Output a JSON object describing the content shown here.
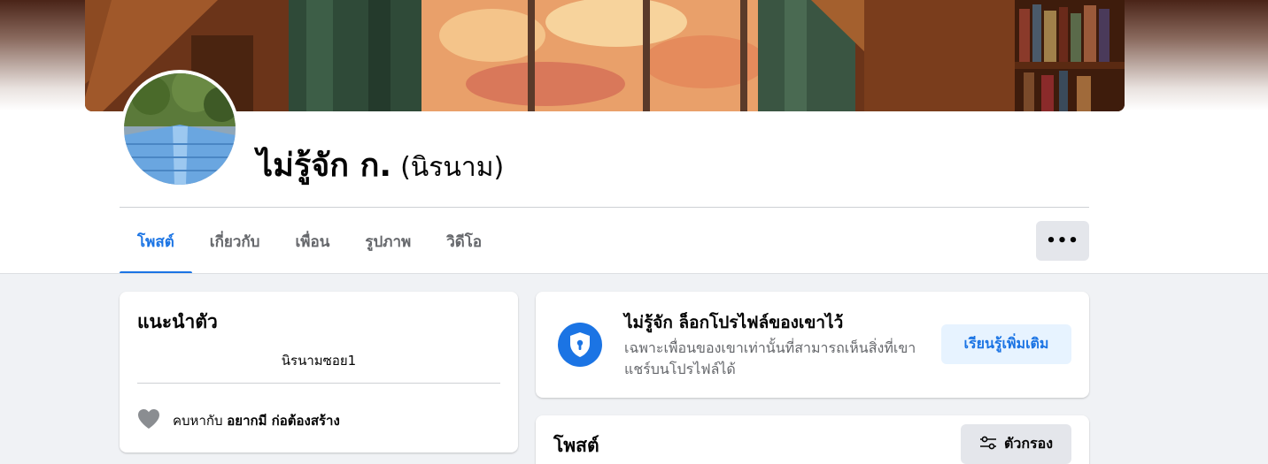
{
  "profile": {
    "name": "ไม่รู้จัก ก.",
    "alternate_name": "(นิรนาม)"
  },
  "tabs": [
    {
      "label": "โพสต์",
      "active": true
    },
    {
      "label": "เกี่ยวกับ",
      "active": false
    },
    {
      "label": "เพื่อน",
      "active": false
    },
    {
      "label": "รูปภาพ",
      "active": false
    },
    {
      "label": "วิดีโอ",
      "active": false
    }
  ],
  "more_button": {
    "label": "•••",
    "icon": "more-icon"
  },
  "intro": {
    "title": "แนะนำตัว",
    "bio": "นิรนามซอย1",
    "relationship_prefix": "คบหากับ",
    "relationship_name": "อยากมี ก่อต้องสร้าง",
    "relationship_icon": "heart-icon"
  },
  "locked_notice": {
    "title": "ไม่รู้จัก ล็อกโปรไฟล์ของเขาไว้",
    "description": "เฉพาะเพื่อนของเขาเท่านั้นที่สามารถเห็นสิ่งที่เขาแชร์บนโปรไฟล์ได้",
    "button_label": "เรียนรู้เพิ่มเติม",
    "icon": "shield-lock-icon"
  },
  "posts": {
    "title": "โพสต์",
    "filter_label": "ตัวกรอง",
    "filter_icon": "filter-sliders-icon"
  },
  "colors": {
    "accent": "#1b74e4",
    "accent_light": "#e7f3ff",
    "secondary_text": "#65676b",
    "page_bg": "#f0f2f5",
    "button_gray": "#e4e6eb"
  }
}
